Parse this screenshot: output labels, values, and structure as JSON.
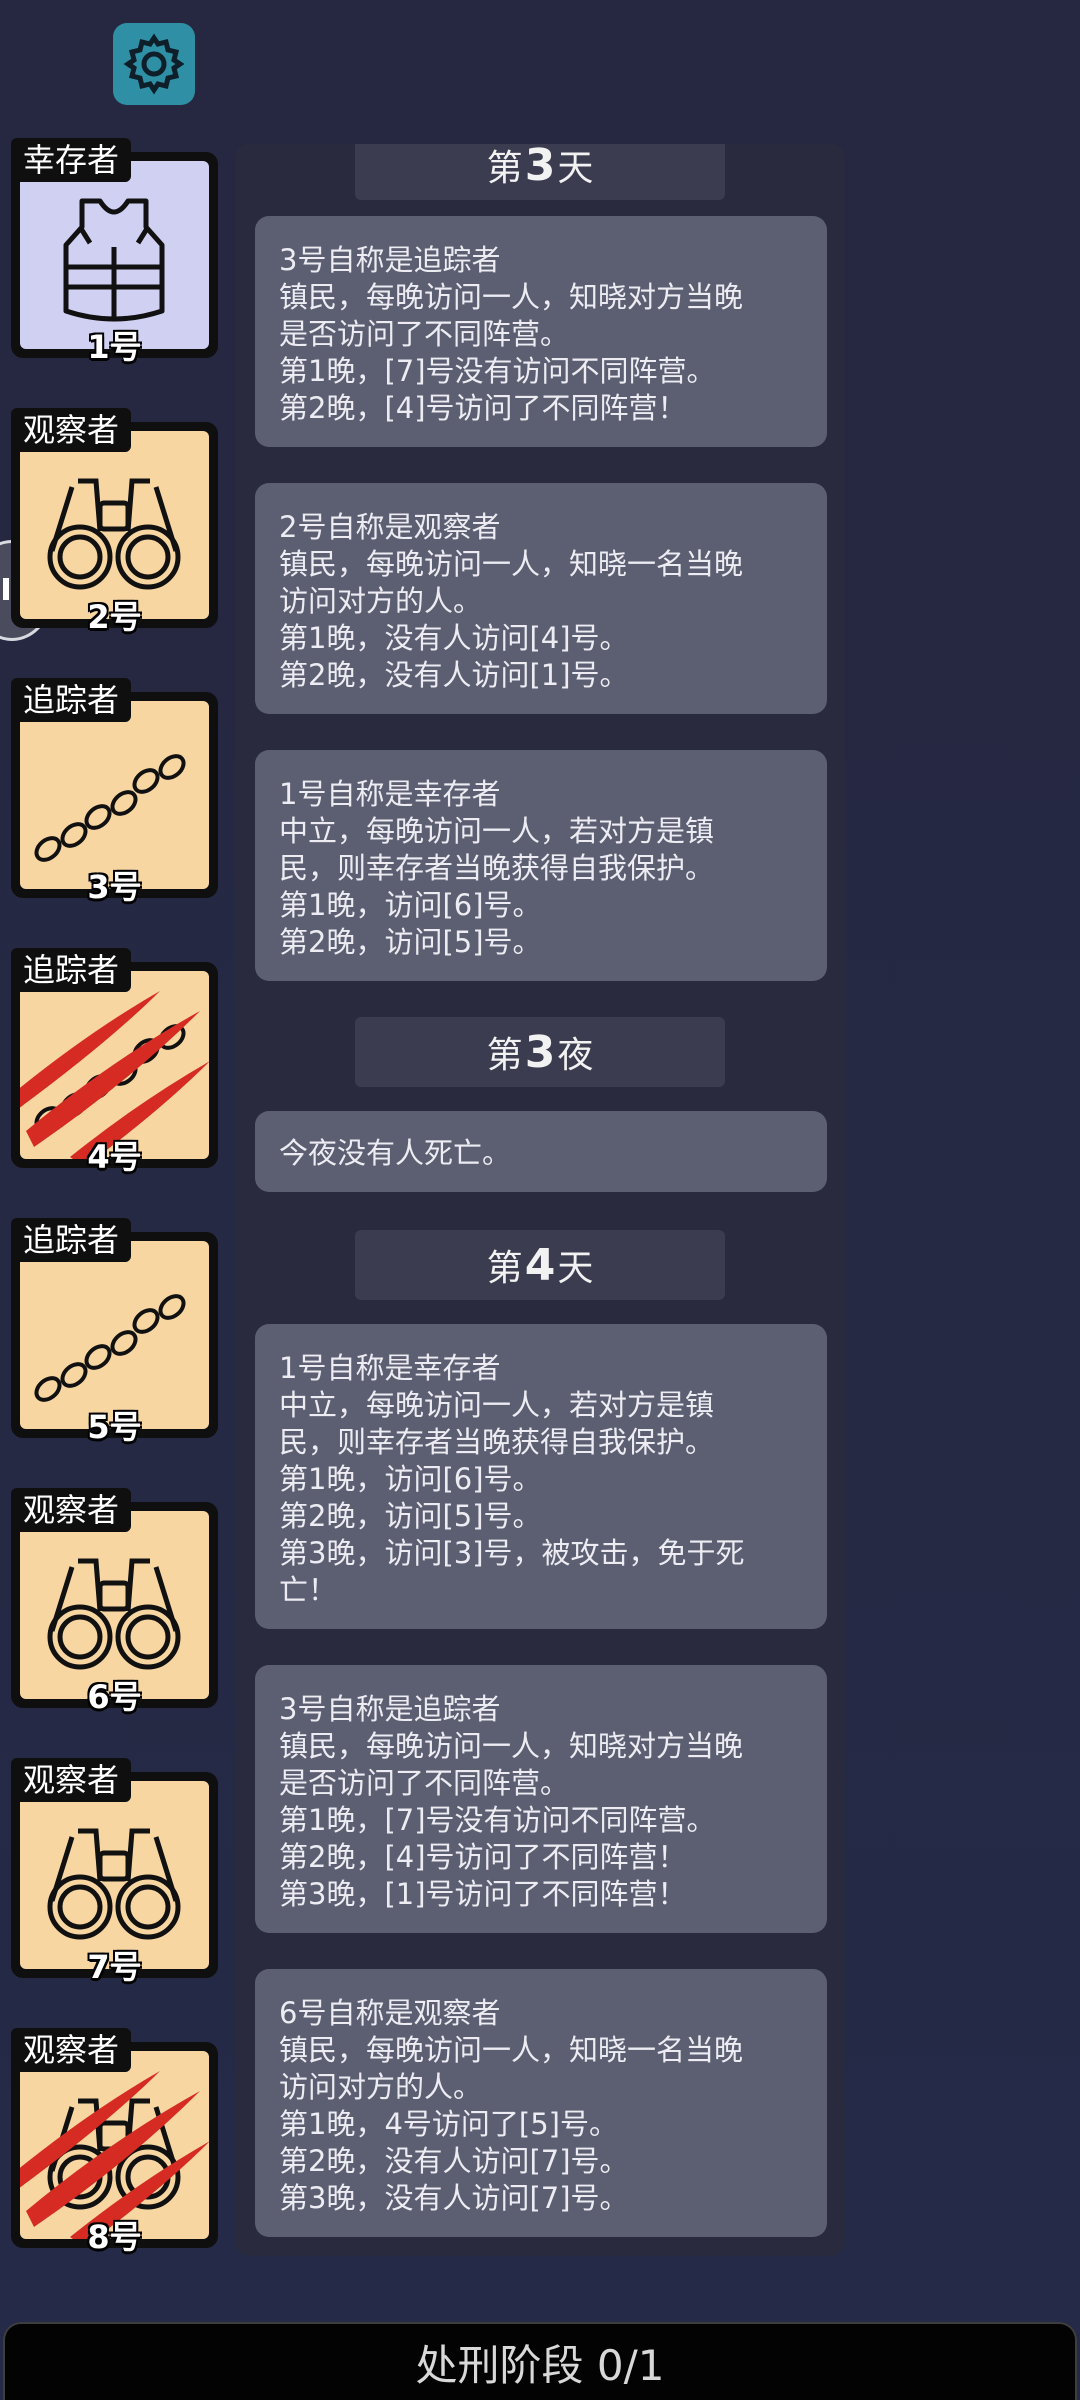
{
  "settings": {
    "icon": "gear-icon"
  },
  "players": [
    {
      "number_label": "1号",
      "role": "幸存者",
      "icon": "vest-icon",
      "dead": false
    },
    {
      "number_label": "2号",
      "role": "观察者",
      "icon": "binoculars-icon",
      "dead": false
    },
    {
      "number_label": "3号",
      "role": "追踪者",
      "icon": "footprints-icon",
      "dead": false
    },
    {
      "number_label": "4号",
      "role": "追踪者",
      "icon": "footprints-icon",
      "dead": true
    },
    {
      "number_label": "5号",
      "role": "追踪者",
      "icon": "footprints-icon",
      "dead": false
    },
    {
      "number_label": "6号",
      "role": "观察者",
      "icon": "binoculars-icon",
      "dead": false
    },
    {
      "number_label": "7号",
      "role": "观察者",
      "icon": "binoculars-icon",
      "dead": false
    },
    {
      "number_label": "8号",
      "role": "观察者",
      "icon": "binoculars-icon",
      "dead": true
    }
  ],
  "log": {
    "day3": {
      "prefix": "第",
      "num": "3",
      "suffix": "天"
    },
    "night3": {
      "prefix": "第",
      "num": "3",
      "suffix": "夜"
    },
    "day4": {
      "prefix": "第",
      "num": "4",
      "suffix": "天"
    },
    "messages": [
      {
        "lines": [
          "3号自称是追踪者",
          "镇民，每晚访问一人，知晓对方当晚",
          "是否访问了不同阵营。",
          "第1晚，[7]号没有访问不同阵营。",
          "第2晚，[4]号访问了不同阵营！"
        ]
      },
      {
        "lines": [
          "2号自称是观察者",
          "镇民，每晚访问一人，知晓一名当晚",
          "访问对方的人。",
          "第1晚，没有人访问[4]号。",
          "第2晚，没有人访问[1]号。"
        ]
      },
      {
        "lines": [
          "1号自称是幸存者",
          "中立，每晚访问一人，若对方是镇",
          "民，则幸存者当晚获得自我保护。",
          "第1晚，访问[6]号。",
          "第2晚，访问[5]号。"
        ]
      },
      {
        "lines": [
          "今夜没有人死亡。"
        ]
      },
      {
        "lines": [
          "1号自称是幸存者",
          "中立，每晚访问一人，若对方是镇",
          "民，则幸存者当晚获得自我保护。",
          "第1晚，访问[6]号。",
          "第2晚，访问[5]号。",
          "第3晚，访问[3]号，被攻击，免于死",
          "亡！"
        ]
      },
      {
        "lines": [
          "3号自称是追踪者",
          "镇民，每晚访问一人，知晓对方当晚",
          "是否访问了不同阵营。",
          "第1晚，[7]号没有访问不同阵营。",
          "第2晚，[4]号访问了不同阵营！",
          "第3晚，[1]号访问了不同阵营！"
        ]
      },
      {
        "lines": [
          "6号自称是观察者",
          "镇民，每晚访问一人，知晓一名当晚",
          "访问对方的人。",
          "第1晚，4号访问了[5]号。",
          "第2晚，没有人访问[7]号。",
          "第3晚，没有人访问[7]号。"
        ]
      }
    ]
  },
  "bottom_bar": {
    "label": "处刑阶段 0/1"
  }
}
